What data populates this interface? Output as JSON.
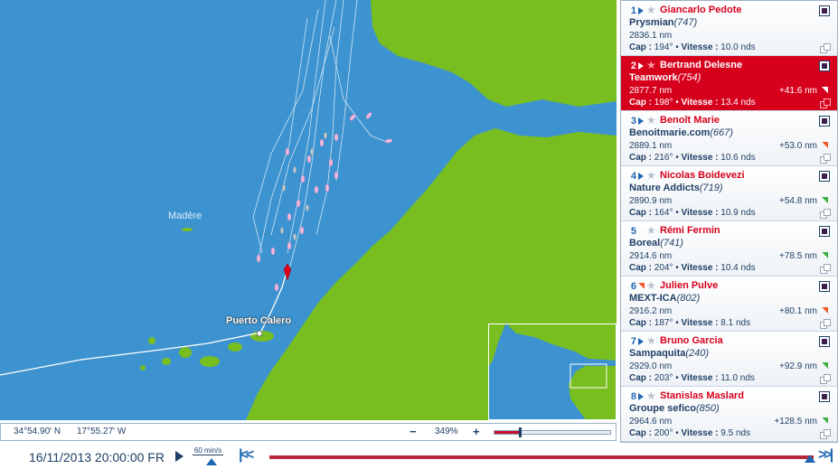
{
  "map": {
    "labels": {
      "madere": "Madère",
      "port": "Puerto Calero"
    }
  },
  "coordbar": {
    "lat": "34°54.90' N",
    "lon": "17°55.27' W",
    "zoom_minus": "−",
    "zoom_level": "349%",
    "zoom_plus": "+",
    "zoom_fraction": 0.22
  },
  "timeline": {
    "date": "16/11/2013 20:00:00 FR",
    "speed": "60 min/s",
    "rewind": "|<<",
    "forward": ">>|"
  },
  "colors": {
    "sea": "#3d93cf",
    "land": "#78be20",
    "accent": "#d6001c",
    "text": "#1f3f66"
  },
  "ranking": [
    {
      "rank": "1",
      "trend_icon": "play-arrow",
      "name": "Giancarlo Pedote",
      "boat": "Prysmian",
      "sail": "(747)",
      "distance": "2836.1 nm",
      "gap": "",
      "gap_trend": "",
      "cap_label": "Cap :",
      "cap": "194°",
      "sep": "•",
      "vit_label": "Vitesse :",
      "vitesse": "10.0 nds",
      "selected": false
    },
    {
      "rank": "2",
      "trend_icon": "play-arrow",
      "name": "Bertrand Delesne",
      "boat": "Teamwork",
      "sail": "(754)",
      "distance": "2877.7 nm",
      "gap": "+41.6 nm",
      "gap_trend": "white",
      "cap_label": "Cap :",
      "cap": "198°",
      "sep": "•",
      "vit_label": "Vitesse :",
      "vitesse": "13.4 nds",
      "selected": true
    },
    {
      "rank": "3",
      "trend_icon": "play-arrow",
      "name": "Benoît Marie",
      "boat": "Benoitmarie.com",
      "sail": "(667)",
      "distance": "2889.1 nm",
      "gap": "+53.0 nm",
      "gap_trend": "orange",
      "cap_label": "Cap :",
      "cap": "216°",
      "sep": "•",
      "vit_label": "Vitesse :",
      "vitesse": "10.6 nds",
      "selected": false
    },
    {
      "rank": "4",
      "trend_icon": "play-arrow",
      "name": "Nicolas Boidevezi",
      "boat": "Nature Addicts",
      "sail": "(719)",
      "distance": "2890.9 nm",
      "gap": "+54.8 nm",
      "gap_trend": "green",
      "cap_label": "Cap :",
      "cap": "164°",
      "sep": "•",
      "vit_label": "Vitesse :",
      "vitesse": "10.9 nds",
      "selected": false
    },
    {
      "rank": "5",
      "trend_icon": "green-up",
      "name": "Rémi Fermin",
      "boat": "Boreal",
      "sail": "(741)",
      "distance": "2914.6 nm",
      "gap": "+78.5 nm",
      "gap_trend": "green",
      "cap_label": "Cap :",
      "cap": "204°",
      "sep": "•",
      "vit_label": "Vitesse :",
      "vitesse": "10.4 nds",
      "selected": false
    },
    {
      "rank": "6",
      "trend_icon": "orange-down",
      "name": "Julien Pulve",
      "boat": "MEXT-ICA",
      "sail": "(802)",
      "distance": "2916.2 nm",
      "gap": "+80.1 nm",
      "gap_trend": "orange",
      "cap_label": "Cap :",
      "cap": "187°",
      "sep": "•",
      "vit_label": "Vitesse :",
      "vitesse": "8.1 nds",
      "selected": false
    },
    {
      "rank": "7",
      "trend_icon": "play-arrow",
      "name": "Bruno Garcia",
      "boat": "Sampaquita",
      "sail": "(240)",
      "distance": "2929.0 nm",
      "gap": "+92.9 nm",
      "gap_trend": "green",
      "cap_label": "Cap :",
      "cap": "203°",
      "sep": "•",
      "vit_label": "Vitesse :",
      "vitesse": "11.0 nds",
      "selected": false
    },
    {
      "rank": "8",
      "trend_icon": "play-arrow",
      "name": "Stanislas Maslard",
      "boat": "Groupe sefico",
      "sail": "(850)",
      "distance": "2964.6 nm",
      "gap": "+128.5 nm",
      "gap_trend": "green",
      "cap_label": "Cap :",
      "cap": "200°",
      "sep": "•",
      "vit_label": "Vitesse :",
      "vitesse": "9.5 nds",
      "selected": false
    }
  ]
}
